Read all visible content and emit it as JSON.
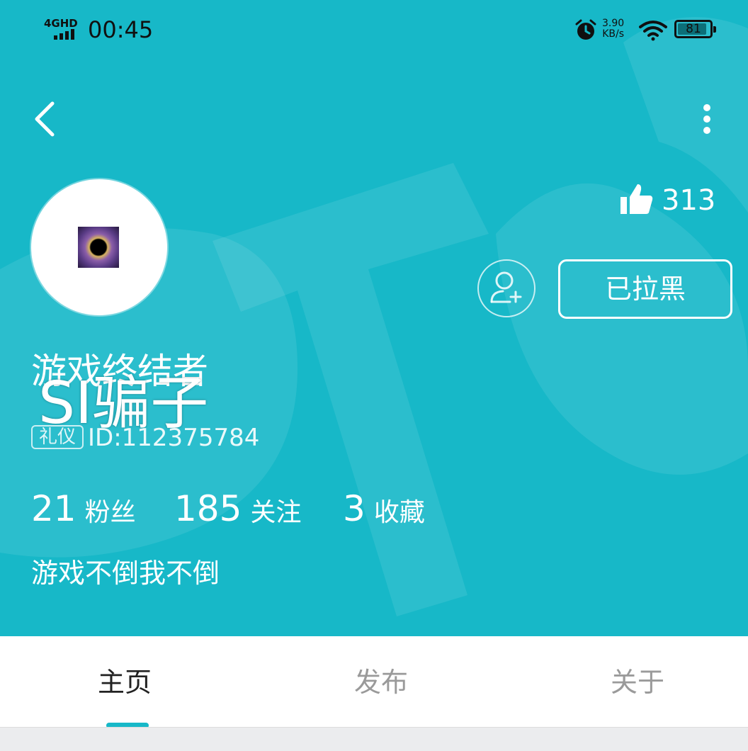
{
  "status_bar": {
    "network": "4GHD",
    "time": "00:45",
    "net_speed_value": "3.90",
    "net_speed_unit": "KB/s",
    "battery": "81"
  },
  "profile": {
    "likes": "313",
    "blocked_label": "已拉黑",
    "username": "游戏终结者",
    "overlay_text": "SI骗子",
    "badge": "礼仪",
    "id": "ID:112375784",
    "stats": [
      {
        "value": "21",
        "label": "粉丝"
      },
      {
        "value": "185",
        "label": "关注"
      },
      {
        "value": "3",
        "label": "收藏"
      }
    ],
    "bio": "游戏不倒我不倒"
  },
  "tabs": [
    {
      "label": "主页",
      "active": true
    },
    {
      "label": "发布",
      "active": false
    },
    {
      "label": "关于",
      "active": false
    }
  ],
  "colors": {
    "header_bg": "#17b8c8",
    "accent": "#17b8c8"
  },
  "icons": [
    "back-arrow-icon",
    "more-vertical-icon",
    "thumbs-up-icon",
    "add-user-icon",
    "alarm-icon",
    "wifi-icon",
    "battery-icon",
    "signal-icon"
  ]
}
